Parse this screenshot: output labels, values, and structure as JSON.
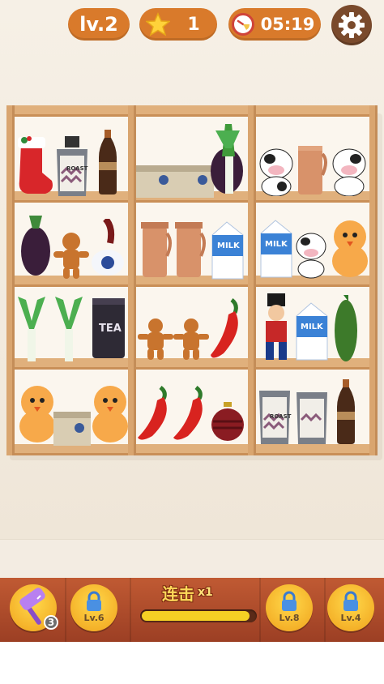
{
  "hud": {
    "level_label": "lv.2",
    "stars_count": "1",
    "timer": "05:19",
    "settings": "gear-icon"
  },
  "shelf": {
    "labels": {
      "roast": "ROAST",
      "milk": "MILK",
      "tea": "TEA"
    }
  },
  "bottom_bar": {
    "hammer": {
      "icon": "hammer-icon",
      "count": "3"
    },
    "locked_boosters": [
      {
        "label": "Lv.6",
        "icon": "lock-icon"
      },
      {
        "label": "Lv.8",
        "icon": "lock-icon"
      },
      {
        "label": "Lv.4",
        "icon": "lock-icon"
      }
    ],
    "combo": {
      "label": "连击",
      "multiplier": "x1",
      "progress": 0.95
    }
  }
}
